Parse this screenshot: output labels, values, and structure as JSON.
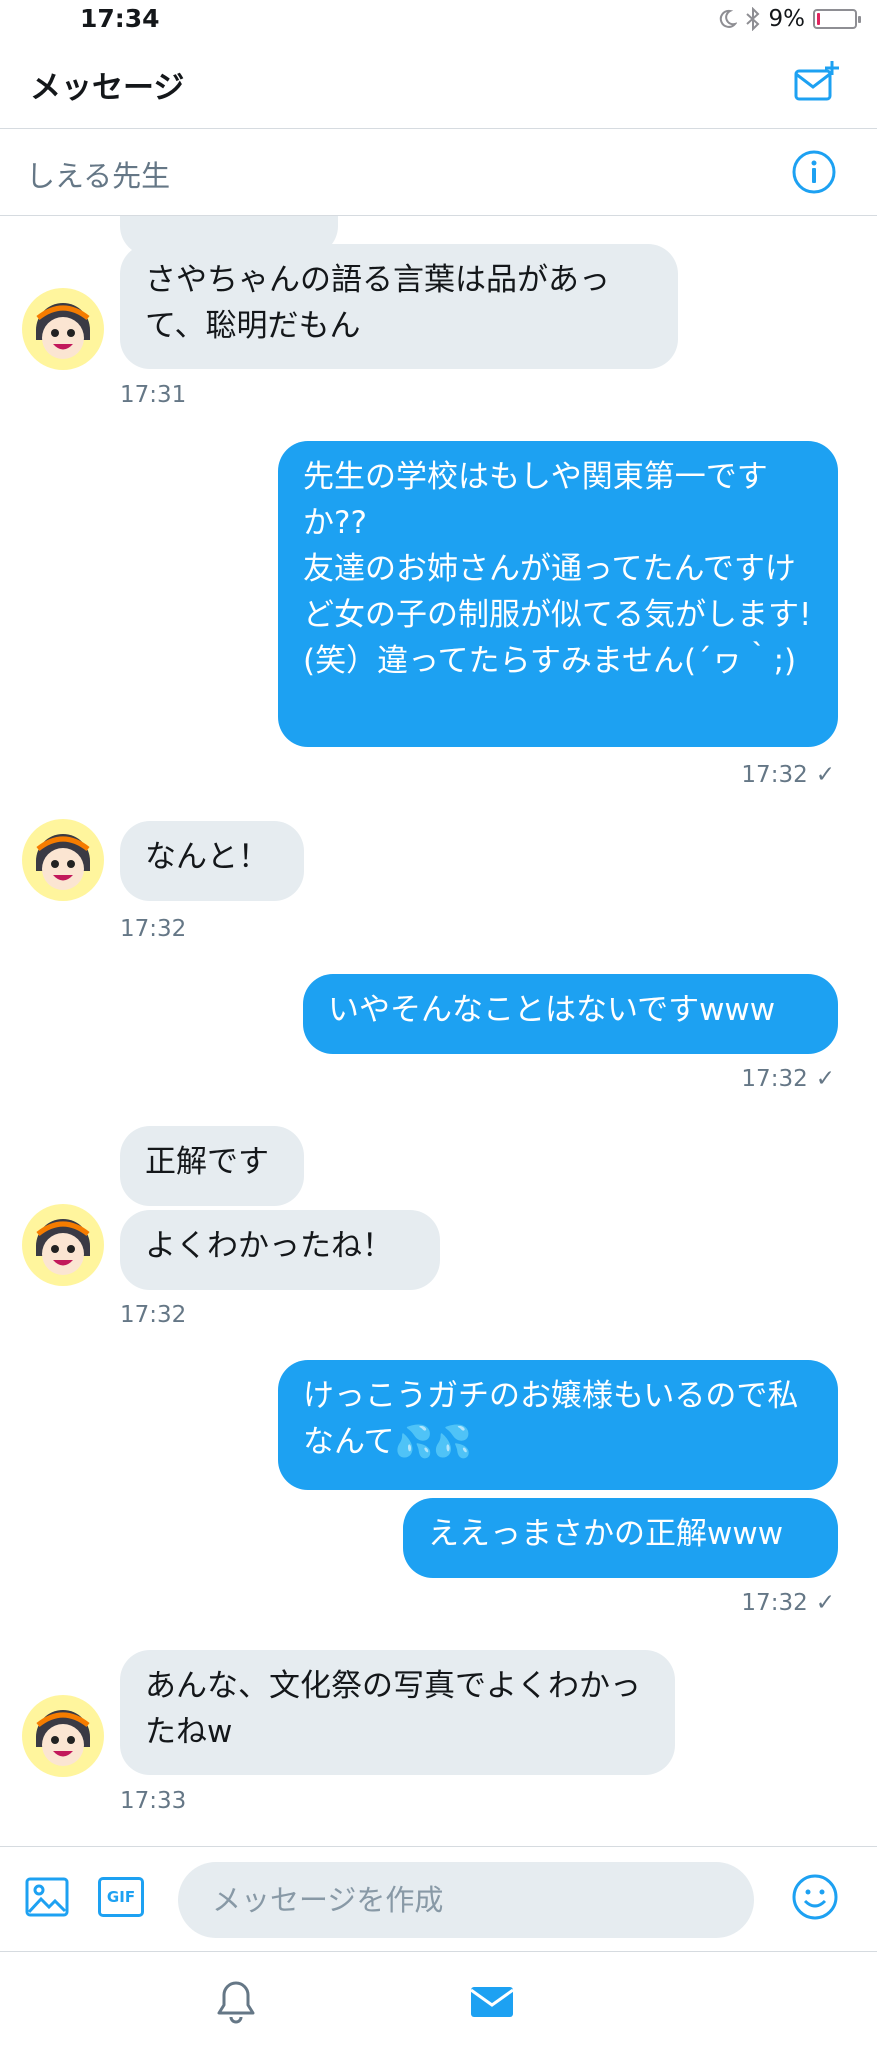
{
  "status": {
    "time": "17:34",
    "battery": "9%",
    "battery_level": 0.09
  },
  "header": {
    "title": "メッセージ",
    "new_message_icon": "compose-mail-icon"
  },
  "conversation": {
    "name": "しえる先生",
    "info_icon": "info-icon"
  },
  "messages": [
    {
      "dir": "in",
      "text": ""
    },
    {
      "dir": "in",
      "text": "さやちゃんの語る言葉は品があって、聡明だもん"
    },
    {
      "timestamp": "17:31"
    },
    {
      "dir": "out",
      "text": "先生の学校はもしや関東第一ですか??\n友達のお姉さんが通ってたんですけど女の子の制服が似てる気がします!(笑）違ってたらすみません(´ヮ｀;)"
    },
    {
      "timestamp": "17:32",
      "check": "✓"
    },
    {
      "dir": "in",
      "text": "なんと！"
    },
    {
      "timestamp": "17:32"
    },
    {
      "dir": "out",
      "text": "いやそんなことはないですwww"
    },
    {
      "timestamp": "17:32",
      "check": "✓"
    },
    {
      "dir": "in",
      "text": "正解です"
    },
    {
      "dir": "in",
      "text": "よくわかったね！"
    },
    {
      "timestamp": "17:32"
    },
    {
      "dir": "out",
      "text": "けっこうガチのお嬢様もいるので私なんて💦💦"
    },
    {
      "dir": "out",
      "text": "ええっまさかの正解www"
    },
    {
      "timestamp": "17:32",
      "check": "✓"
    },
    {
      "dir": "in",
      "text": "あんな、文化祭の写真でよくわかったねw"
    },
    {
      "timestamp": "17:33"
    }
  ],
  "composer": {
    "placeholder": "メッセージを作成",
    "gif_label": "GIF",
    "image_icon": "image-icon",
    "emoji_icon": "emoji-icon"
  },
  "tabbar": {
    "items": [
      "notifications-bell-icon",
      "messages-envelope-icon"
    ]
  },
  "colors": {
    "accent": "#1da1f2",
    "incoming_bubble": "#e6ecf0",
    "secondary_text": "#657786"
  }
}
